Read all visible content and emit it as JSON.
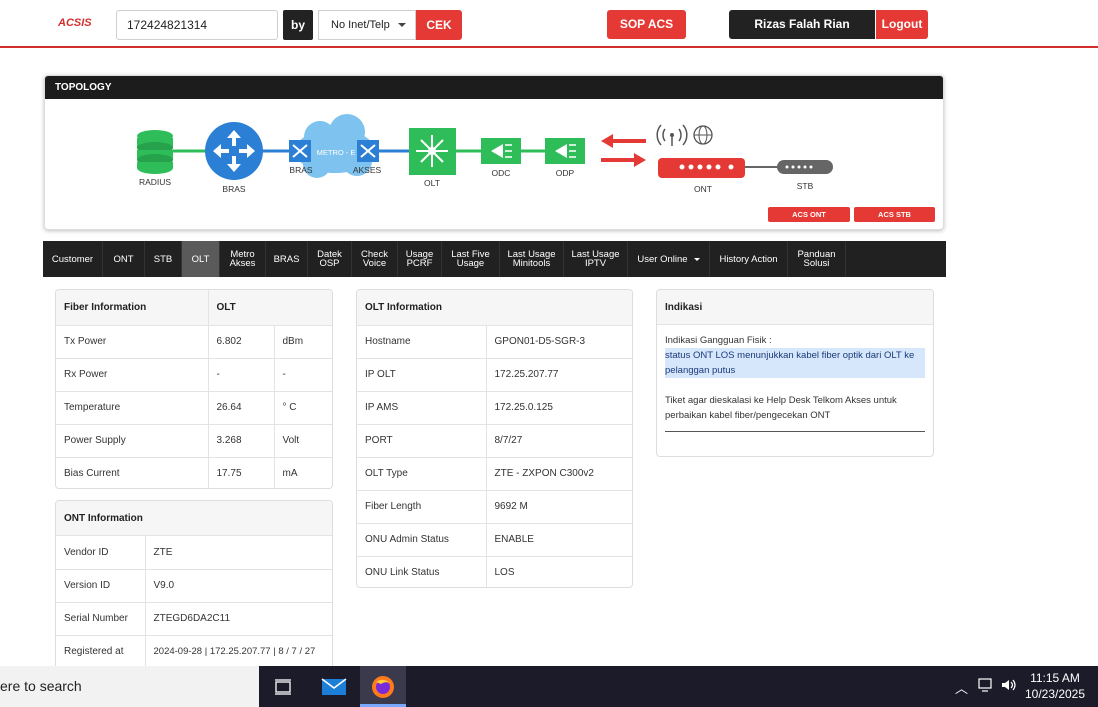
{
  "header": {
    "logo": "ACSIS",
    "search_value": "172424821314",
    "by_label": "by",
    "select_value": "No Inet/Telp",
    "cek_label": "CEK",
    "sop_label": "SOP ACS",
    "user_name": "Rizas Falah Rian Purnama",
    "logout_label": "Logout"
  },
  "topology": {
    "title": "TOPOLOGY",
    "nodes": {
      "radius": "RADIUS",
      "bras": "BRAS",
      "bras2": "BRAS",
      "metro": "METRO - E",
      "akses": "AKSES",
      "olt": "OLT",
      "odc": "ODC",
      "odp": "ODP",
      "ont": "ONT",
      "stb": "STB"
    },
    "acs_ont": "ACS ONT Connectivity",
    "acs_stb": "ACS STB Connectivity",
    "colors": {
      "green": "#2ebd59",
      "blue": "#2b7fd4",
      "red": "#e53935",
      "gray": "#666666"
    }
  },
  "tabs": [
    {
      "l1": "Customer",
      "l2": ""
    },
    {
      "l1": "ONT",
      "l2": ""
    },
    {
      "l1": "STB",
      "l2": ""
    },
    {
      "l1": "OLT",
      "l2": ""
    },
    {
      "l1": "Metro",
      "l2": "Akses"
    },
    {
      "l1": "BRAS",
      "l2": ""
    },
    {
      "l1": "Datek",
      "l2": "OSP"
    },
    {
      "l1": "Check",
      "l2": "Voice"
    },
    {
      "l1": "Usage",
      "l2": "PCRF"
    },
    {
      "l1": "Last Five",
      "l2": "Usage"
    },
    {
      "l1": "Last Usage",
      "l2": "Minitools"
    },
    {
      "l1": "Last Usage",
      "l2": "IPTV"
    },
    {
      "l1": "User Online",
      "l2": ""
    },
    {
      "l1": "History Action",
      "l2": ""
    },
    {
      "l1": "Panduan",
      "l2": "Solusi"
    }
  ],
  "fiber": {
    "h1": "Fiber Information",
    "h2": "OLT",
    "rows": [
      {
        "label": "Tx Power",
        "value": "6.802",
        "unit": "dBm"
      },
      {
        "label": "Rx Power",
        "value": "-",
        "unit": "-"
      },
      {
        "label": "Temperature",
        "value": "26.64",
        "unit": "° C"
      },
      {
        "label": "Power Supply",
        "value": "3.268",
        "unit": "Volt"
      },
      {
        "label": "Bias Current",
        "value": "17.75",
        "unit": "mA"
      }
    ]
  },
  "ont_info": {
    "title": "ONT Information",
    "rows": [
      {
        "label": "Vendor ID",
        "value": "ZTE"
      },
      {
        "label": "Version ID",
        "value": "V9.0"
      },
      {
        "label": "Serial Number",
        "value": "ZTEGD6DA2C11"
      },
      {
        "label": "Registered at",
        "value": "2024-09-28 | 172.25.207.77 | 8 / 7 / 27"
      }
    ]
  },
  "olt_info": {
    "title": "OLT Information",
    "rows": [
      {
        "label": "Hostname",
        "value": "GPON01-D5-SGR-3"
      },
      {
        "label": "IP OLT",
        "value": "172.25.207.77"
      },
      {
        "label": "IP AMS",
        "value": "172.25.0.125"
      },
      {
        "label": "PORT",
        "value": "8/7/27"
      },
      {
        "label": "OLT Type",
        "value": "ZTE - ZXPON C300v2"
      },
      {
        "label": "Fiber Length",
        "value": "9692 M"
      },
      {
        "label": "ONU Admin Status",
        "value": "ENABLE"
      },
      {
        "label": "ONU Link Status",
        "value": "LOS"
      }
    ]
  },
  "indikasi": {
    "title": "Indikasi",
    "line1": "Indikasi Gangguan Fisik :",
    "line2": "status ONT LOS menunjukkan kabel fiber optik dari OLT ke pelanggan putus",
    "line3": "Tiket agar dieskalasi ke Help Desk Telkom Akses untuk perbaikan kabel fiber/pengecekan ONT"
  },
  "taskbar": {
    "search_text": "ere to search",
    "time": "11:15 AM",
    "date": "10/23/2025"
  }
}
